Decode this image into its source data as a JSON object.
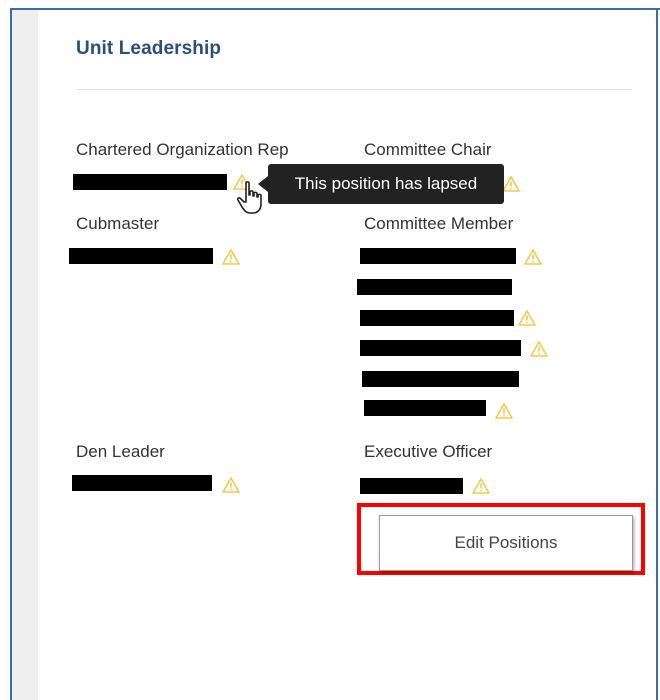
{
  "card": {
    "title": "Unit Leadership"
  },
  "positions": {
    "chartered_org_rep": "Chartered Organization Rep",
    "committee_chair": "Committee Chair",
    "cubmaster": "Cubmaster",
    "committee_member": "Committee Member",
    "den_leader": "Den Leader",
    "executive_officer": "Executive Officer"
  },
  "tooltip": {
    "text": "This position has lapsed"
  },
  "actions": {
    "edit_positions_label": "Edit Positions"
  },
  "icons": {
    "lapsed_warning": "warning-triangle-icon",
    "cursor": "hand-pointer-icon"
  },
  "colors": {
    "title": "#2b4f78",
    "frame_border": "#3b6fa3",
    "warning": "#f2c94c",
    "tooltip_bg": "#222222",
    "highlight": "#ff0000"
  }
}
